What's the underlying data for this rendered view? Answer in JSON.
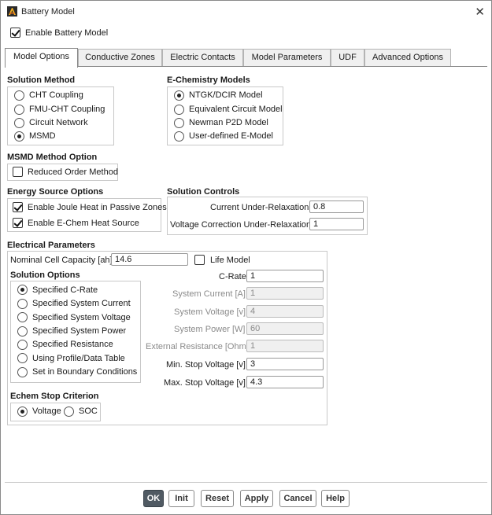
{
  "window": {
    "title": "Battery Model",
    "close_glyph": "✕"
  },
  "enable_battery": {
    "label": "Enable Battery Model",
    "checked": true
  },
  "tabs": [
    {
      "label": "Model Options",
      "active": true
    },
    {
      "label": "Conductive Zones"
    },
    {
      "label": "Electric Contacts"
    },
    {
      "label": "Model Parameters"
    },
    {
      "label": "UDF"
    },
    {
      "label": "Advanced Options"
    }
  ],
  "solution_method": {
    "title": "Solution Method",
    "options": [
      "CHT Coupling",
      "FMU-CHT Coupling",
      "Circuit Network",
      "MSMD"
    ],
    "selected": "MSMD"
  },
  "echem_models": {
    "title": "E-Chemistry Models",
    "options": [
      "NTGK/DCIR Model",
      "Equivalent Circuit Model",
      "Newman P2D Model",
      "User-defined E-Model"
    ],
    "selected": "NTGK/DCIR Model"
  },
  "msmd_option": {
    "title": "MSMD Method Option",
    "reduced_order_label": "Reduced Order Method"
  },
  "energy_source": {
    "title": "Energy Source Options",
    "joule_label": "Enable Joule Heat in Passive Zones",
    "echem_heat_label": "Enable E-Chem Heat Source"
  },
  "solution_controls": {
    "title": "Solution Controls",
    "current_label": "Current Under-Relaxation",
    "current_value": "0.8",
    "voltage_label": "Voltage Correction Under-Relaxation",
    "voltage_value": "1"
  },
  "electrical": {
    "title": "Electrical Parameters",
    "capacity_label": "Nominal Cell Capacity [ah]",
    "capacity_value": "14.6",
    "life_model_label": "Life Model"
  },
  "solution_options": {
    "title": "Solution Options",
    "options": [
      "Specified C-Rate",
      "Specified System Current",
      "Specified System Voltage",
      "Specified System Power",
      "Specified Resistance",
      "Using Profile/Data Table",
      "Set in Boundary Conditions"
    ],
    "selected": "Specified C-Rate"
  },
  "params": {
    "c_rate_label": "C-Rate",
    "c_rate_value": "1",
    "sys_current_label": "System Current [A]",
    "sys_current_value": "1",
    "sys_voltage_label": "System Voltage [v]",
    "sys_voltage_value": "4",
    "sys_power_label": "System Power [W]",
    "sys_power_value": "60",
    "ext_res_label": "External Resistance [Ohm]",
    "ext_res_value": "1",
    "min_stop_label": "Min. Stop Voltage [v]",
    "min_stop_value": "3",
    "max_stop_label": "Max. Stop Voltage [v]",
    "max_stop_value": "4.3"
  },
  "stop_criterion": {
    "title": "Echem Stop Criterion",
    "voltage_label": "Voltage",
    "soc_label": "SOC",
    "selected": "Voltage"
  },
  "buttons": {
    "ok": "OK",
    "init": "Init",
    "reset": "Reset",
    "apply": "Apply",
    "cancel": "Cancel",
    "help": "Help"
  },
  "colors": {
    "primary_button": "#505a63",
    "border": "#8a8a8a"
  }
}
